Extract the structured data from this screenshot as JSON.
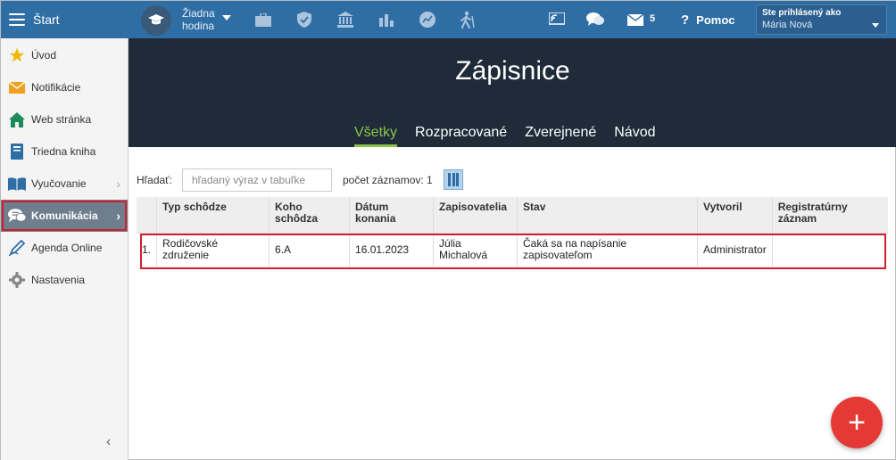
{
  "topbar": {
    "start_label": "Štart",
    "hodina_line1": "Žiadna",
    "hodina_line2": "hodina",
    "message_count": "5",
    "help_label": "Pomoc",
    "user_line1": "Ste prihlásený ako",
    "user_line2": "Mária Nová",
    "accent_color": "#2f6ea5"
  },
  "sidebar": {
    "items": [
      {
        "label": "Úvod",
        "icon": "star-icon"
      },
      {
        "label": "Notifikácie",
        "icon": "envelope-icon"
      },
      {
        "label": "Web stránka",
        "icon": "home-icon"
      },
      {
        "label": "Triedna kniha",
        "icon": "book-icon"
      },
      {
        "label": "Vyučovanie",
        "icon": "education-book-icon"
      },
      {
        "label": "Komunikácia",
        "icon": "chat-icon"
      },
      {
        "label": "Agenda Online",
        "icon": "pen-icon"
      },
      {
        "label": "Nastavenia",
        "icon": "gear-icon"
      }
    ]
  },
  "page": {
    "title": "Zápisnice",
    "tabs": [
      "Všetky",
      "Rozpracované",
      "Zverejnené",
      "Návod"
    ]
  },
  "toolbar": {
    "search_label": "Hľadať:",
    "search_placeholder": "hľadaný výraz v tabuľke",
    "count_label": "počet záznamov: 1"
  },
  "table": {
    "headers": [
      "",
      "Typ schôdze",
      "Koho schôdza",
      "Dátum konania",
      "Zapisovatelia",
      "Stav",
      "Vytvoril",
      "Registratúrny záznam"
    ],
    "rows": [
      [
        "1.",
        "Rodičovské združenie",
        "6.A",
        "16.01.2023",
        "Júlia Michalová",
        "Čaká sa na napísanie zapisovateľom",
        "Administrator",
        ""
      ]
    ]
  },
  "fab_label": "+"
}
